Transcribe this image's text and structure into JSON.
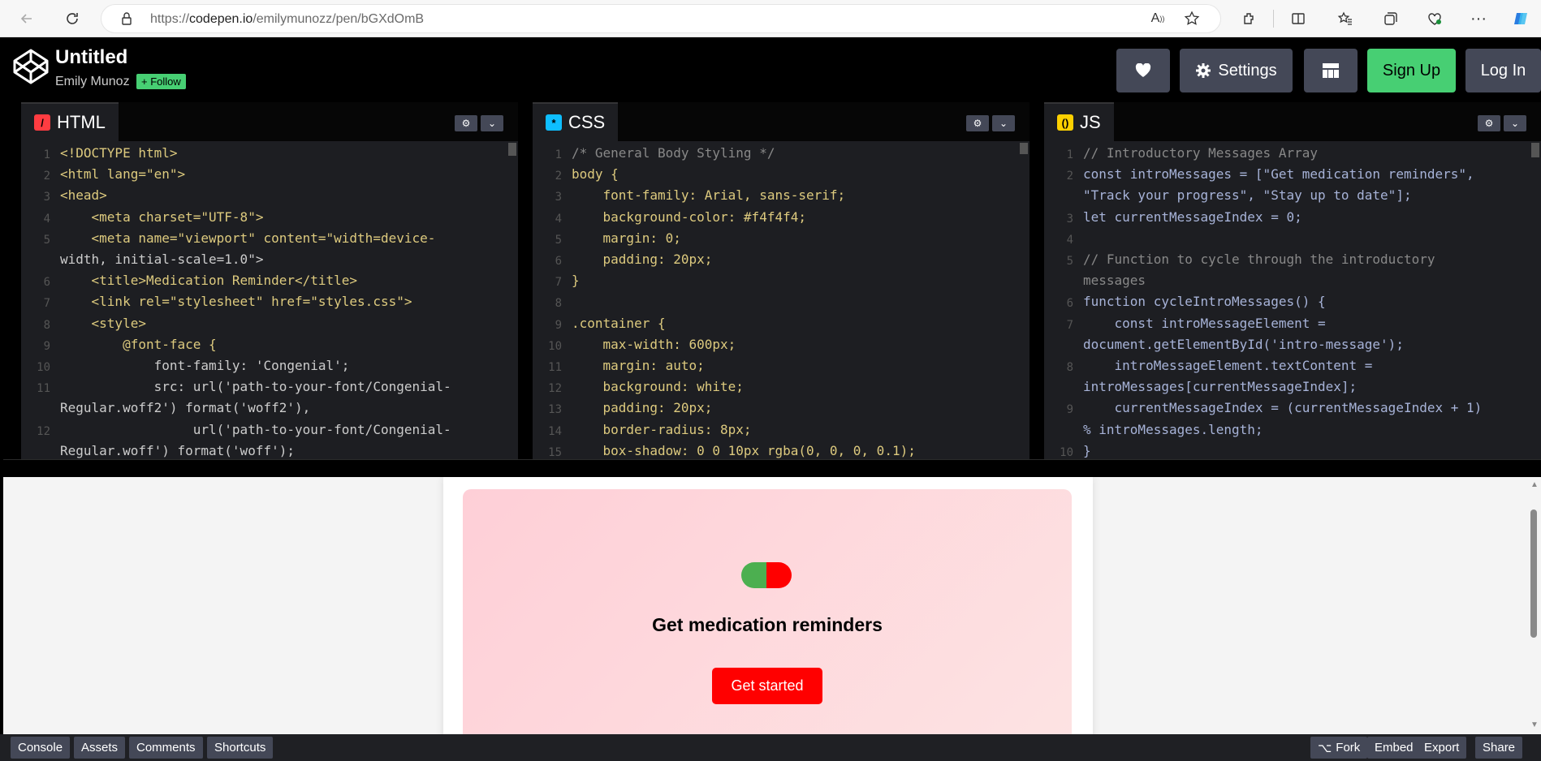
{
  "browser": {
    "url_prefix": "https://",
    "url_domain": "codepen.io",
    "url_path": "/emilymunozz/pen/bGXdOmB"
  },
  "header": {
    "title": "Untitled",
    "author": "Emily Munoz",
    "follow_label": "+ Follow",
    "settings_label": "Settings",
    "signup_label": "Sign Up",
    "login_label": "Log In"
  },
  "editors": {
    "html": {
      "label": "HTML",
      "icon_color": "#ff3c41"
    },
    "css": {
      "label": "CSS",
      "icon_color": "#0ebeff"
    },
    "js": {
      "label": "JS",
      "icon_color": "#fcd000"
    }
  },
  "code_html": [
    {
      "n": "1",
      "t": "<!DOCTYPE html>"
    },
    {
      "n": "2",
      "t": "<html lang=\"en\">"
    },
    {
      "n": "3",
      "t": "<head>"
    },
    {
      "n": "4",
      "t": "    <meta charset=\"UTF-8\">"
    },
    {
      "n": "5",
      "t": "    <meta name=\"viewport\" content=\"width=device-"
    },
    {
      "n": "",
      "t": "width, initial-scale=1.0\">"
    },
    {
      "n": "6",
      "t": "    <title>Medication Reminder</title>"
    },
    {
      "n": "7",
      "t": "    <link rel=\"stylesheet\" href=\"styles.css\">"
    },
    {
      "n": "8",
      "t": "    <style>"
    },
    {
      "n": "9",
      "t": "        @font-face {"
    },
    {
      "n": "10",
      "t": "            font-family: 'Congenial';"
    },
    {
      "n": "11",
      "t": "            src: url('path-to-your-font/Congenial-"
    },
    {
      "n": "",
      "t": "Regular.woff2') format('woff2'),"
    },
    {
      "n": "12",
      "t": "                 url('path-to-your-font/Congenial-"
    },
    {
      "n": "",
      "t": "Regular.woff') format('woff');"
    }
  ],
  "code_css": [
    {
      "n": "1",
      "t": "/* General Body Styling */"
    },
    {
      "n": "2",
      "t": "body {"
    },
    {
      "n": "3",
      "t": "    font-family: Arial, sans-serif;"
    },
    {
      "n": "4",
      "t": "    background-color: #f4f4f4;"
    },
    {
      "n": "5",
      "t": "    margin: 0;"
    },
    {
      "n": "6",
      "t": "    padding: 20px;"
    },
    {
      "n": "7",
      "t": "}"
    },
    {
      "n": "8",
      "t": ""
    },
    {
      "n": "9",
      "t": ".container {"
    },
    {
      "n": "10",
      "t": "    max-width: 600px;"
    },
    {
      "n": "11",
      "t": "    margin: auto;"
    },
    {
      "n": "12",
      "t": "    background: white;"
    },
    {
      "n": "13",
      "t": "    padding: 20px;"
    },
    {
      "n": "14",
      "t": "    border-radius: 8px;"
    },
    {
      "n": "15",
      "t": "    box-shadow: 0 0 10px rgba(0, 0, 0, 0.1);"
    }
  ],
  "code_js": [
    {
      "n": "1",
      "t": "// Introductory Messages Array"
    },
    {
      "n": "2",
      "t": "const introMessages = [\"Get medication reminders\","
    },
    {
      "n": "",
      "t": "\"Track your progress\", \"Stay up to date\"];"
    },
    {
      "n": "3",
      "t": "let currentMessageIndex = 0;"
    },
    {
      "n": "4",
      "t": ""
    },
    {
      "n": "5",
      "t": "// Function to cycle through the introductory"
    },
    {
      "n": "",
      "t": "messages"
    },
    {
      "n": "6",
      "t": "function cycleIntroMessages() {"
    },
    {
      "n": "7",
      "t": "    const introMessageElement ="
    },
    {
      "n": "",
      "t": "document.getElementById('intro-message');"
    },
    {
      "n": "8",
      "t": "    introMessageElement.textContent ="
    },
    {
      "n": "",
      "t": "introMessages[currentMessageIndex];"
    },
    {
      "n": "9",
      "t": "    currentMessageIndex = (currentMessageIndex + 1)"
    },
    {
      "n": "",
      "t": "% introMessages.length;"
    },
    {
      "n": "10",
      "t": "}"
    }
  ],
  "preview": {
    "message": "Get medication reminders",
    "button_label": "Get started",
    "pill_left_color": "#4caf50",
    "pill_right_color": "#ff0000"
  },
  "footer": {
    "left": [
      "Console",
      "Assets",
      "Comments",
      "Shortcuts"
    ],
    "fork_label": "Fork",
    "embed_label": "Embed",
    "export_label": "Export",
    "share_label": "Share"
  }
}
